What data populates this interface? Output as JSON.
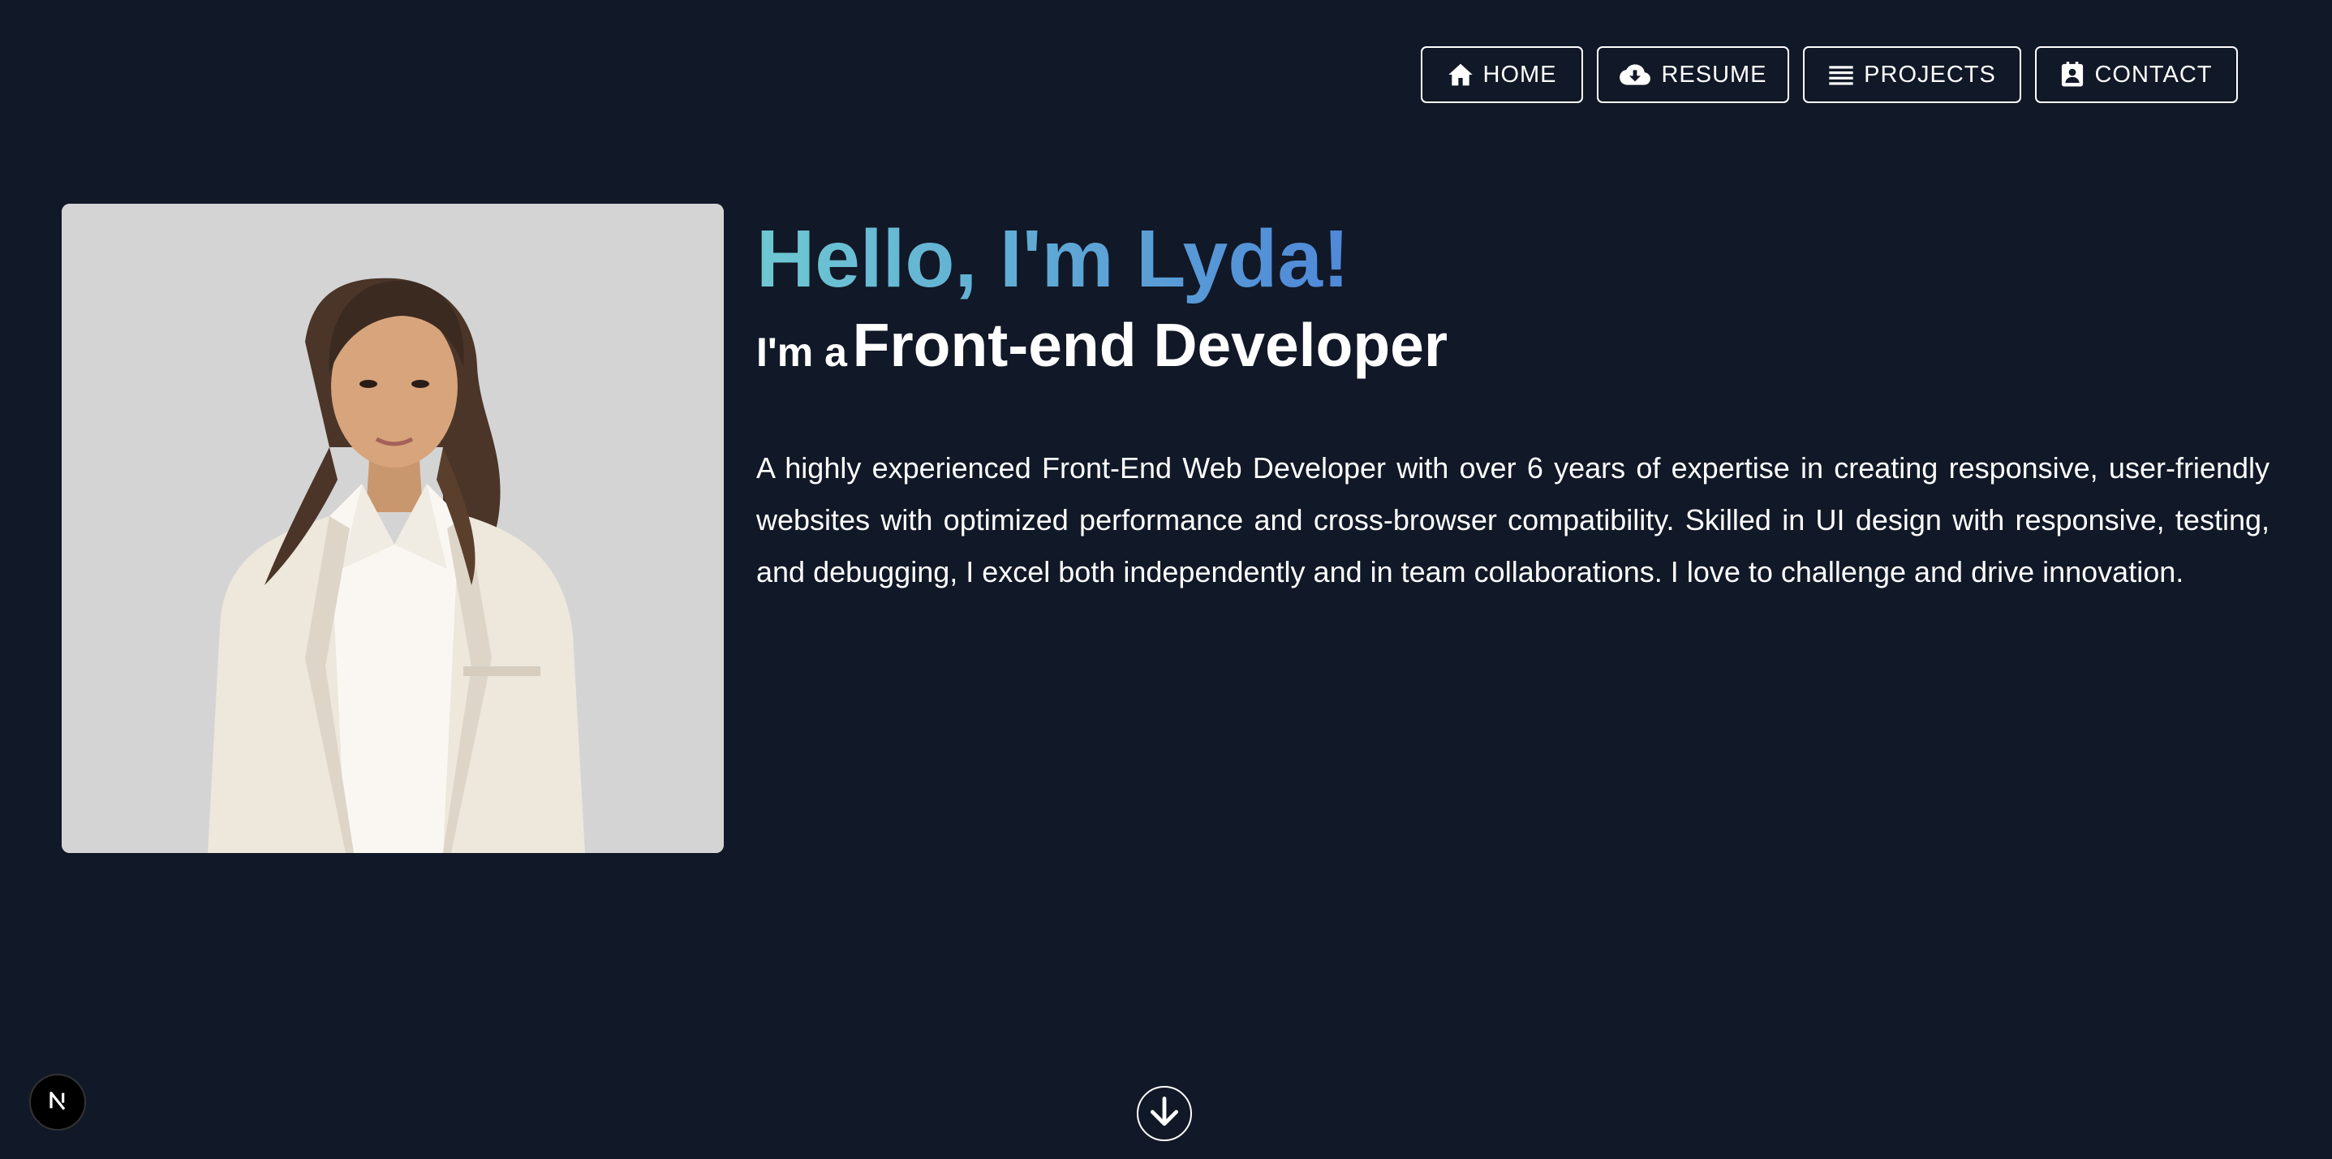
{
  "nav": {
    "items": [
      {
        "label": "HOME",
        "icon": "home-icon"
      },
      {
        "label": "RESUME",
        "icon": "cloud-download-icon"
      },
      {
        "label": "PROJECTS",
        "icon": "list-icon"
      },
      {
        "label": "CONTACT",
        "icon": "contact-card-icon"
      }
    ]
  },
  "hero": {
    "greeting": "Hello, I'm Lyda!",
    "role_prefix": "I'm a",
    "role_title": "Front-end Developer",
    "bio": "A highly experienced Front-End Web Developer with over 6 years of expertise in creating responsive, user-friendly websites with optimized performance and cross-browser compatibility. Skilled in UI design with responsive, testing, and debugging, I excel both independently and in team collaborations. I love to challenge and drive innovation."
  },
  "colors": {
    "background": "#111827",
    "gradient_start": "#6ec8d2",
    "gradient_end": "#4f88d8",
    "photo_background": "#d4d4d4"
  },
  "icons": {
    "scroll": "arrow-down-icon",
    "badge": "next-js-icon"
  }
}
